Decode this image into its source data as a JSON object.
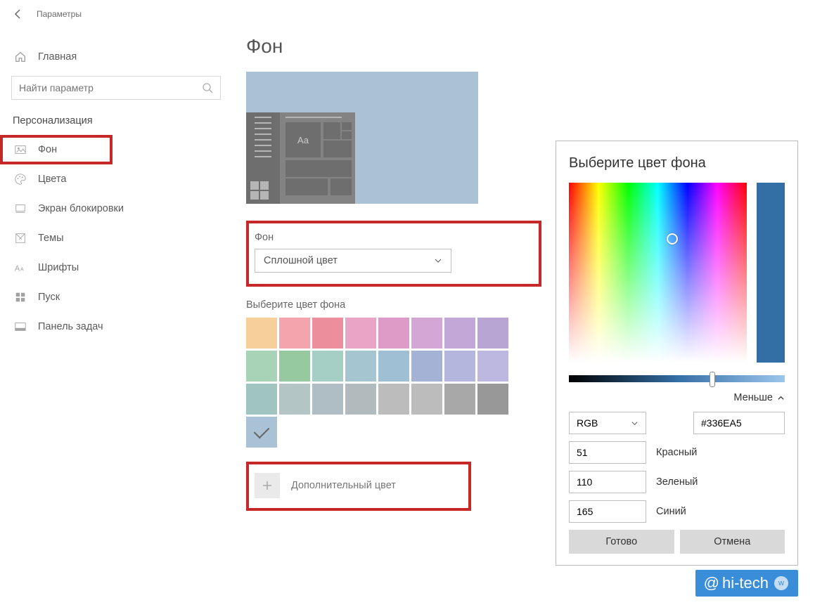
{
  "window": {
    "title": "Параметры"
  },
  "sidebar": {
    "home": "Главная",
    "search_placeholder": "Найти параметр",
    "section": "Персонализация",
    "items": [
      {
        "label": "Фон",
        "icon": "image-icon",
        "highlighted": true
      },
      {
        "label": "Цвета",
        "icon": "palette-icon"
      },
      {
        "label": "Экран блокировки",
        "icon": "lock-screen-icon"
      },
      {
        "label": "Темы",
        "icon": "themes-icon"
      },
      {
        "label": "Шрифты",
        "icon": "fonts-icon"
      },
      {
        "label": "Пуск",
        "icon": "start-icon"
      },
      {
        "label": "Панель задач",
        "icon": "taskbar-icon"
      }
    ]
  },
  "main": {
    "title": "Фон",
    "preview_sample_text": "Aa",
    "background_label": "Фон",
    "background_dropdown_value": "Сплошной цвет",
    "color_grid_label": "Выберите цвет фона",
    "custom_color_label": "Дополнительный цвет",
    "swatches": [
      [
        "#f6cf9a",
        "#f4a4ac",
        "#ec8e9c",
        "#e9a5c6",
        "#df9bc8",
        "#d3a6d6",
        "#c3a7d6",
        "#b9a5d4"
      ],
      [
        "#a8d3b6",
        "#97c9a0",
        "#a5cfc5",
        "#a5c5d1",
        "#9fbfd5",
        "#a4b3d5",
        "#b4b6de",
        "#bdb8e0"
      ],
      [
        "#a0c4c0",
        "#b4c5c5",
        "#afbec4",
        "#b1bbbe",
        "#bcbcbc",
        "#bcbcbc",
        "#a8a8a8",
        "#989898"
      ]
    ],
    "selected_swatch": "#a9c2d6"
  },
  "picker": {
    "title": "Выберите цвет фона",
    "preview_hex": "#336EA5",
    "less_label": "Меньше",
    "mode": "RGB",
    "hex_value": "#336EA5",
    "channels": [
      {
        "label": "Красный",
        "value": "51"
      },
      {
        "label": "Зеленый",
        "value": "110"
      },
      {
        "label": "Синий",
        "value": "165"
      }
    ],
    "done": "Готово",
    "cancel": "Отмена"
  },
  "watermark": {
    "text": "hi-tech"
  }
}
